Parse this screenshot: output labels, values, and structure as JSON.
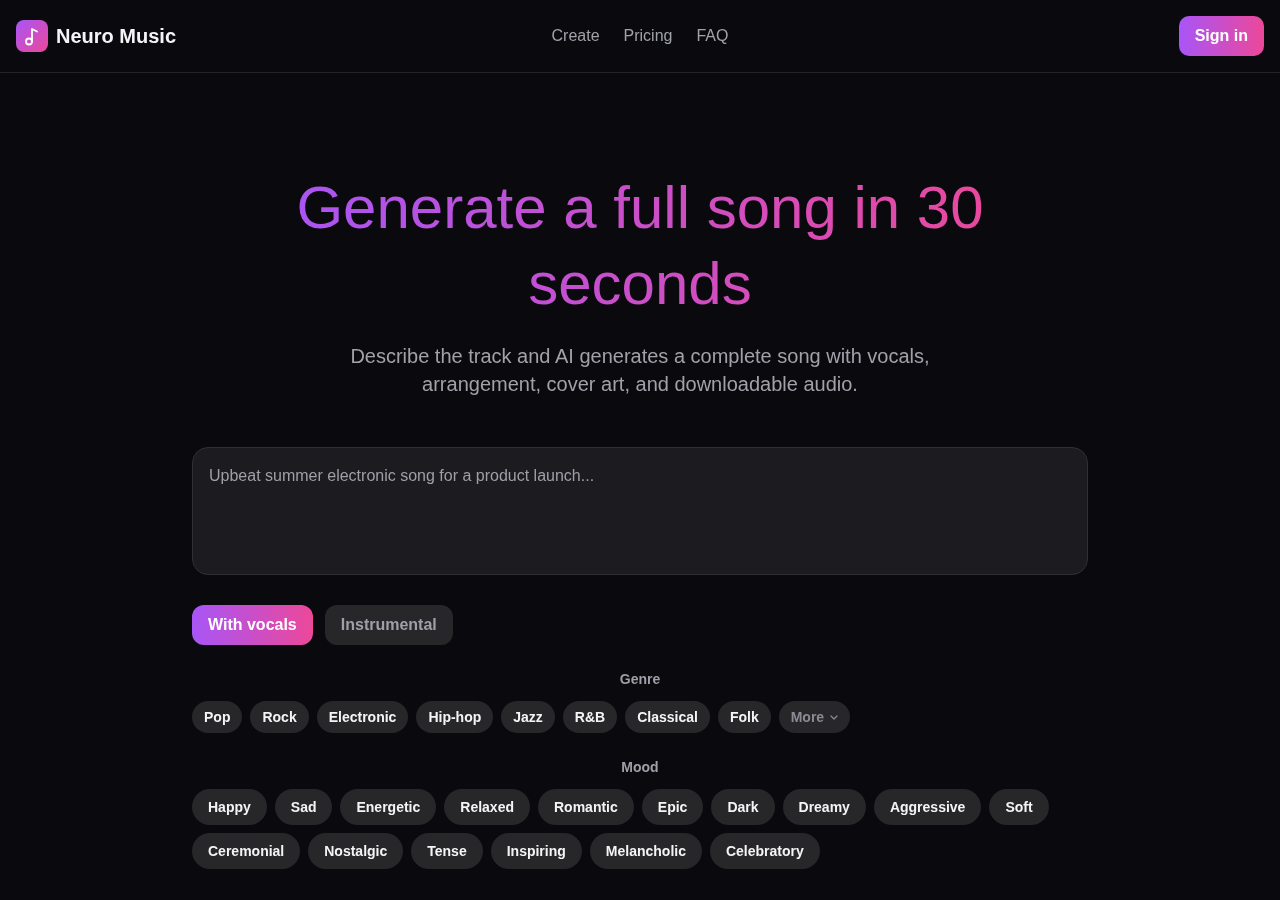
{
  "header": {
    "brand": "Neuro Music",
    "nav": [
      "Create",
      "Pricing",
      "FAQ"
    ],
    "sign_in": "Sign in"
  },
  "hero": {
    "title": "Generate a full song in 30 seconds",
    "subtitle": "Describe the track and AI generates a complete song with vocals, arrangement, cover art, and downloadable audio."
  },
  "prompt": {
    "placeholder": "Upbeat summer electronic song for a product launch..."
  },
  "mode_toggle": [
    {
      "label": "With vocals",
      "selected": true
    },
    {
      "label": "Instrumental",
      "selected": false
    }
  ],
  "genre": {
    "label": "Genre",
    "chips": [
      {
        "label": "Pop",
        "selected": false
      },
      {
        "label": "Rock",
        "selected": false
      },
      {
        "label": "Electronic",
        "selected": false
      },
      {
        "label": "Hip-hop",
        "selected": false
      },
      {
        "label": "Jazz",
        "selected": false
      },
      {
        "label": "R&B",
        "selected": false
      },
      {
        "label": "Classical",
        "selected": false
      },
      {
        "label": "Folk",
        "selected": false
      }
    ],
    "more": "More"
  },
  "mood": {
    "label": "Mood",
    "chips": [
      {
        "label": "Happy",
        "selected": false
      },
      {
        "label": "Sad",
        "selected": false
      },
      {
        "label": "Energetic",
        "selected": false
      },
      {
        "label": "Relaxed",
        "selected": false
      },
      {
        "label": "Romantic",
        "selected": false
      },
      {
        "label": "Epic",
        "selected": false
      },
      {
        "label": "Dark",
        "selected": false
      },
      {
        "label": "Dreamy",
        "selected": false
      },
      {
        "label": "Aggressive",
        "selected": false
      },
      {
        "label": "Soft",
        "selected": false
      },
      {
        "label": "Ceremonial",
        "selected": false
      },
      {
        "label": "Nostalgic",
        "selected": false
      },
      {
        "label": "Tense",
        "selected": false
      },
      {
        "label": "Inspiring",
        "selected": false
      },
      {
        "label": "Melancholic",
        "selected": false
      },
      {
        "label": "Celebratory",
        "selected": false
      }
    ]
  }
}
